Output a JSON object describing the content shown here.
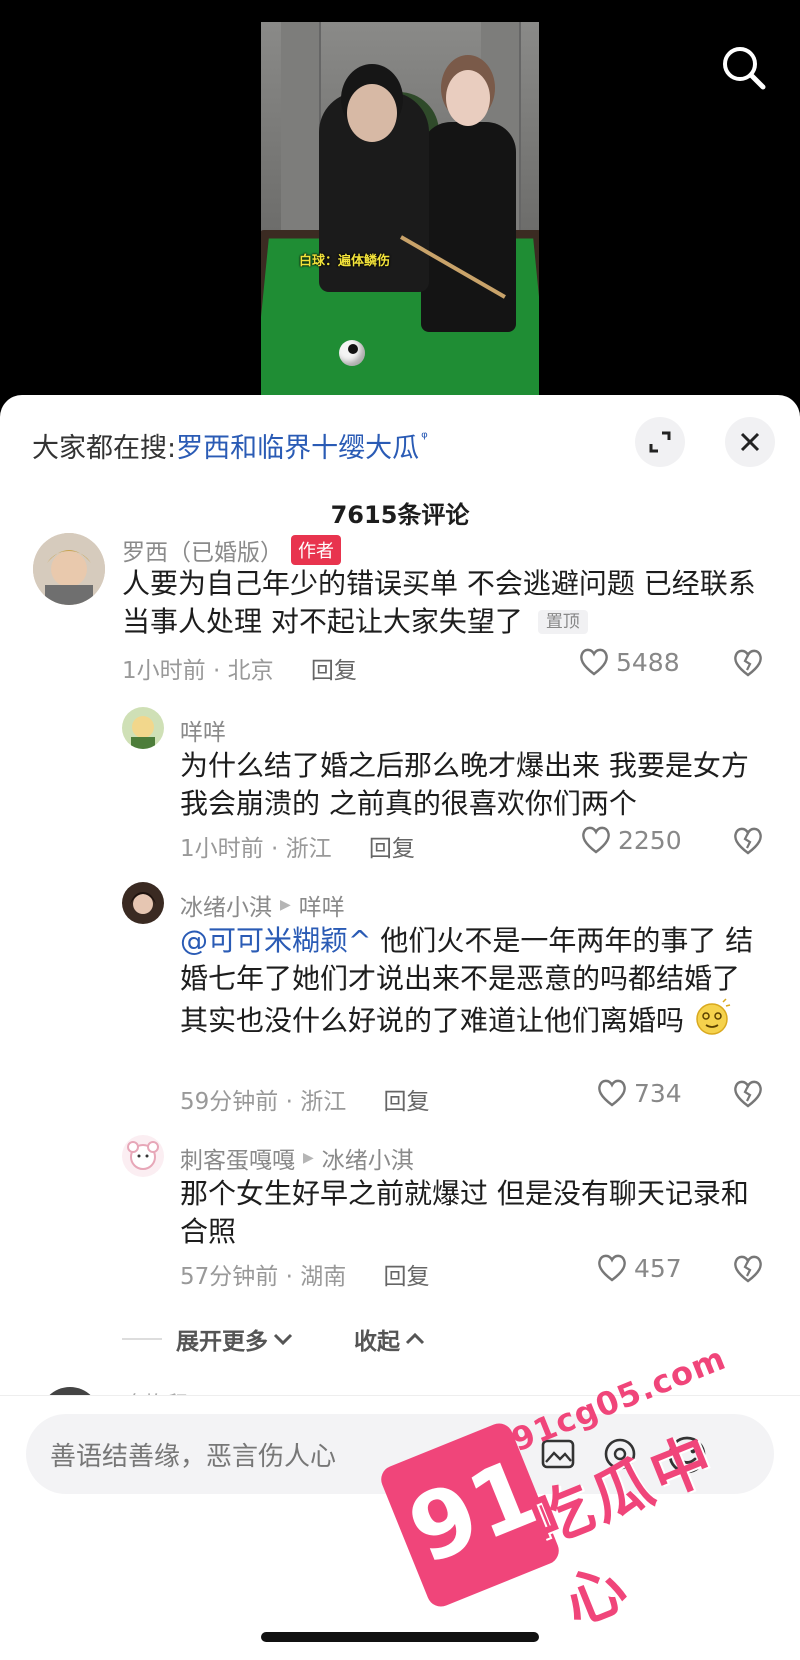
{
  "video": {
    "caption": "白球：遍体鳞伤"
  },
  "hot_search": {
    "prefix": "大家都在搜:",
    "query": "罗西和临界十缨大瓜",
    "query_icon": "search-mini-icon"
  },
  "comment_count": "7615条评论",
  "comments": [
    {
      "user": "罗西（已婚版）",
      "badge": "作者",
      "text": "人要为自己年少的错误买单 不会逃避问题 已经联系当事人处理 对不起让大家失望了",
      "pin": "置顶",
      "meta": "1小时前 · 北京",
      "reply_label": "回复",
      "likes": "5488"
    },
    {
      "user": "咩咩",
      "text": "为什么结了婚之后那么晚才爆出来 我要是女方我会崩溃的 之前真的很喜欢你们两个",
      "meta": "1小时前 · 浙江",
      "reply_label": "回复",
      "likes": "2250"
    },
    {
      "user": "冰绪小淇",
      "reply_to": "咩咩",
      "mention": "@可可米糊颖^",
      "text": " 他们火不是一年两年的事了 结婚七年了她们才说出来不是恶意的吗都结婚了其实也没什么好说的了难道让他们离婚吗",
      "meta": "59分钟前 · 浙江",
      "reply_label": "回复",
      "likes": "734"
    },
    {
      "user": "刺客蛋嘎嘎",
      "reply_to": "冰绪小淇",
      "text": "那个女生好早之前就爆过 但是没有聊天记录和合照",
      "meta": "57分钟前 · 湖南",
      "reply_label": "回复",
      "likes": "457"
    }
  ],
  "expand_label": "展开更多",
  "collapse_label": "收起",
  "next_comment_user": "晚炸留",
  "input": {
    "placeholder": "善语结善缘，恶言伤人心"
  },
  "watermark": {
    "number": "91",
    "url": "91cg05.com",
    "name": "吃瓜中心"
  },
  "colors": {
    "author_badge": "#e8344e",
    "link": "#2a5bb5",
    "watermark": "#f0457a"
  }
}
